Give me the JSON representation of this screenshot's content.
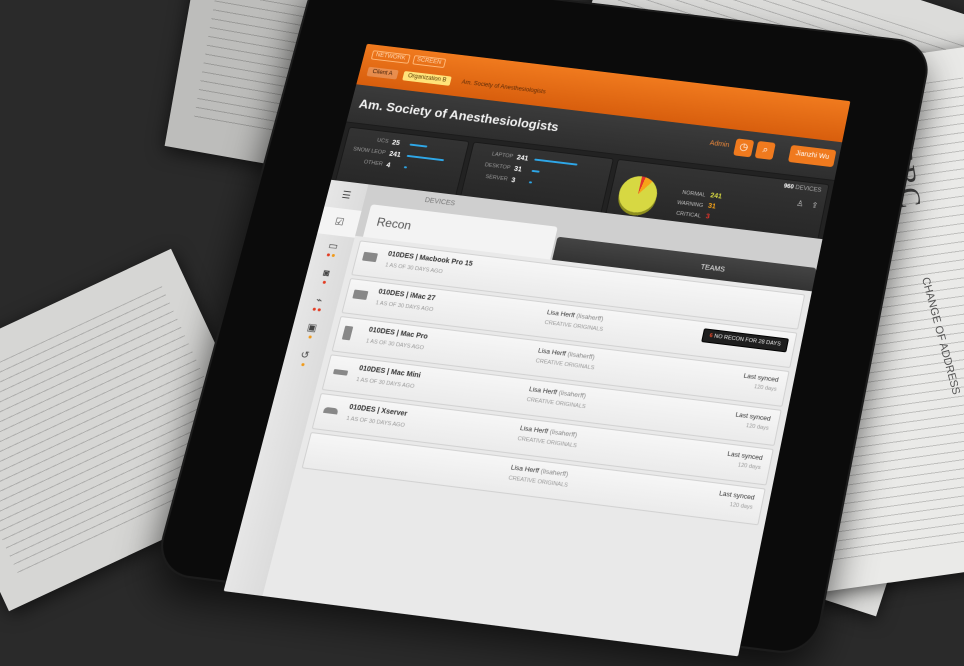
{
  "app": {
    "brand_left": "NETWORK",
    "brand_right": "SCREEN",
    "crumbs": [
      "Client A",
      "Organization B"
    ],
    "crumb_path": "Am. Society of Anesthesiologists"
  },
  "header": {
    "title": "Am. Society of Anesthesiologists",
    "admin_label": "Admin",
    "user_name": "Jianzhi Wu"
  },
  "stats": {
    "group1": [
      {
        "label": "UCS",
        "value": "25"
      },
      {
        "label": "SNOW LEOP",
        "value": "241"
      },
      {
        "label": "OTHER",
        "value": "4"
      }
    ],
    "group2": [
      {
        "label": "LAPTOP",
        "value": "241"
      },
      {
        "label": "DESKTOP",
        "value": "31"
      },
      {
        "label": "SERVER",
        "value": "3"
      }
    ],
    "total_value": "960",
    "total_label": "DEVICES",
    "health": [
      {
        "label": "NORMAL",
        "value": "241",
        "color": "#d7d842"
      },
      {
        "label": "WARNING",
        "value": "31",
        "color": "#f7a318"
      },
      {
        "label": "CRITICAL",
        "value": "3",
        "color": "#e2342a"
      }
    ]
  },
  "tabs": {
    "devices": "DEVICES",
    "teams": "TEAMS",
    "recon_title": "Recon"
  },
  "sidebar": {
    "items": [
      {
        "icon": "list-icon"
      },
      {
        "icon": "checklist-icon"
      },
      {
        "icon": "laptop-icon"
      },
      {
        "icon": "camera-icon"
      },
      {
        "icon": "pulse-icon"
      },
      {
        "icon": "battery-icon"
      },
      {
        "icon": "history-icon"
      }
    ]
  },
  "alert": {
    "count": "6",
    "text": "NO RECON FOR 28 DAYS"
  },
  "devices": [
    {
      "name": "010DES | Macbook Pro 15",
      "sub": "1 AS OF 30 DAYS AGO",
      "owner": "",
      "owner_handle": "",
      "org": "",
      "synced_label": "",
      "synced_value": ""
    },
    {
      "name": "010DES | iMac 27",
      "sub": "1 AS OF 30 DAYS AGO",
      "owner": "Lisa Herff",
      "owner_handle": "(lisaherff)",
      "org": "CREATIVE ORIGINALS",
      "synced_label": "",
      "synced_value": ""
    },
    {
      "name": "010DES | Mac Pro",
      "sub": "1 AS OF 30 DAYS AGO",
      "owner": "Lisa Herff",
      "owner_handle": "(lisaherff)",
      "org": "CREATIVE ORIGINALS",
      "synced_label": "Last synced",
      "synced_value": "120 days"
    },
    {
      "name": "010DES | Mac Mini",
      "sub": "1 AS OF 30 DAYS AGO",
      "owner": "Lisa Herff",
      "owner_handle": "(lisaherff)",
      "org": "CREATIVE ORIGINALS",
      "synced_label": "Last synced",
      "synced_value": "120 days"
    },
    {
      "name": "010DES | Xserver",
      "sub": "1 AS OF 30 DAYS AGO",
      "owner": "Lisa Herff",
      "owner_handle": "(lisaherff)",
      "org": "CREATIVE ORIGINALS",
      "synced_label": "Last synced",
      "synced_value": "120 days"
    },
    {
      "name": "",
      "sub": "",
      "owner": "Lisa Herff",
      "owner_handle": "(lisaherff)",
      "org": "CREATIVE ORIGINALS",
      "synced_label": "Last synced",
      "synced_value": "120 days"
    }
  ],
  "background": {
    "bank_logo": "HSBC",
    "address_note": "CHANGE OF ADDRESS"
  }
}
